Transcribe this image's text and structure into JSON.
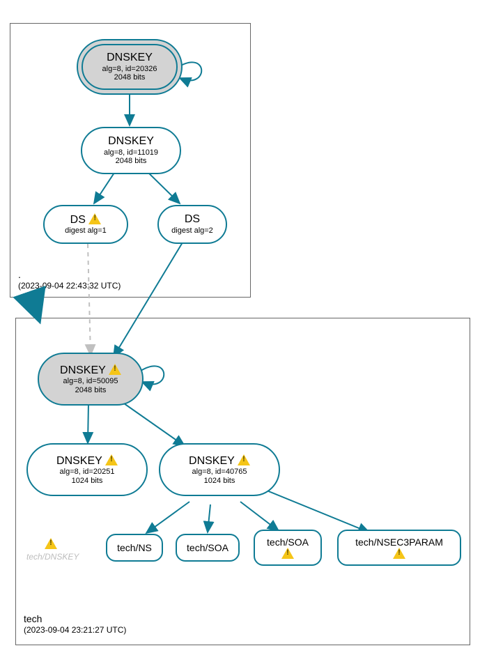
{
  "zones": {
    "root": {
      "name": ".",
      "timestamp": "(2023-09-04 22:43:32 UTC)"
    },
    "tld": {
      "name": "tech",
      "timestamp": "(2023-09-04 23:21:27 UTC)"
    }
  },
  "nodes": {
    "root_ksk": {
      "title": "DNSKEY",
      "sub1": "alg=8, id=20326",
      "sub2": "2048 bits"
    },
    "root_zsk": {
      "title": "DNSKEY",
      "sub1": "alg=8, id=11019",
      "sub2": "2048 bits"
    },
    "ds1": {
      "title": "DS",
      "sub1": "digest alg=1",
      "warn": true
    },
    "ds2": {
      "title": "DS",
      "sub1": "digest alg=2",
      "warn": false
    },
    "tld_ksk": {
      "title": "DNSKEY",
      "sub1": "alg=8, id=50095",
      "sub2": "2048 bits",
      "warn": true
    },
    "tld_zsk1": {
      "title": "DNSKEY",
      "sub1": "alg=8, id=20251",
      "sub2": "1024 bits",
      "warn": true
    },
    "tld_zsk2": {
      "title": "DNSKEY",
      "sub1": "alg=8, id=40765",
      "sub2": "1024 bits",
      "warn": true
    }
  },
  "rrsets": {
    "ns": "tech/NS",
    "soa1": "tech/SOA",
    "soa2": "tech/SOA",
    "nsec3": "tech/NSEC3PARAM"
  },
  "ghost": "tech/DNSKEY"
}
